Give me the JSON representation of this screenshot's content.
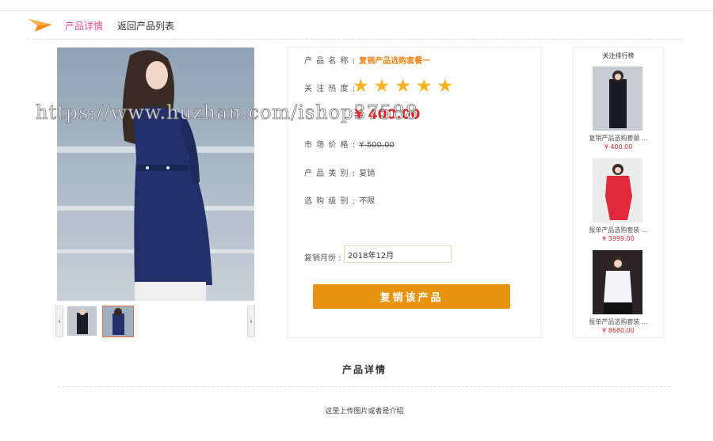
{
  "nav": {
    "active_label": "产品详情",
    "back_label": "返回产品列表"
  },
  "product": {
    "name_label": "产 品 名 称 :",
    "name_value": "复销产品选购套餐一",
    "hot_label": "关 注 热 度 :",
    "rating": 5,
    "rating_max": 5,
    "price_value": "¥ 400.00",
    "market_label": "市 场 价 格 :",
    "market_value": "¥ 500.00",
    "category_label": "产 品 类 别 :",
    "category_value": "复销",
    "level_label": "选 购 级 别 :",
    "level_value": "不限",
    "month_label": "复销月份 :",
    "month_value": "2018年12月",
    "buy_button": "复销该产品"
  },
  "gallery": {
    "prev_label": "‹",
    "next_label": "›",
    "selected_index": 1
  },
  "ranking": {
    "title": "关注排行榜",
    "items": [
      {
        "name": "复销产品选购套餐 ...",
        "price": "¥ 400.00"
      },
      {
        "name": "报单产品选购套装 ...",
        "price": "¥ 3999.00"
      },
      {
        "name": "报单产品选购套装 ...",
        "price": "¥ 8680.00"
      }
    ]
  },
  "detail": {
    "title": "产品详情",
    "text": "这里上传图片或者是介绍"
  },
  "watermark": "https://www.huzhan.com/ishop37588",
  "colors": {
    "accent_pink": "#e5498b",
    "orange": "#f08519",
    "price_red": "#e5242b",
    "button": "#e8940e",
    "star": "#f5b322"
  }
}
